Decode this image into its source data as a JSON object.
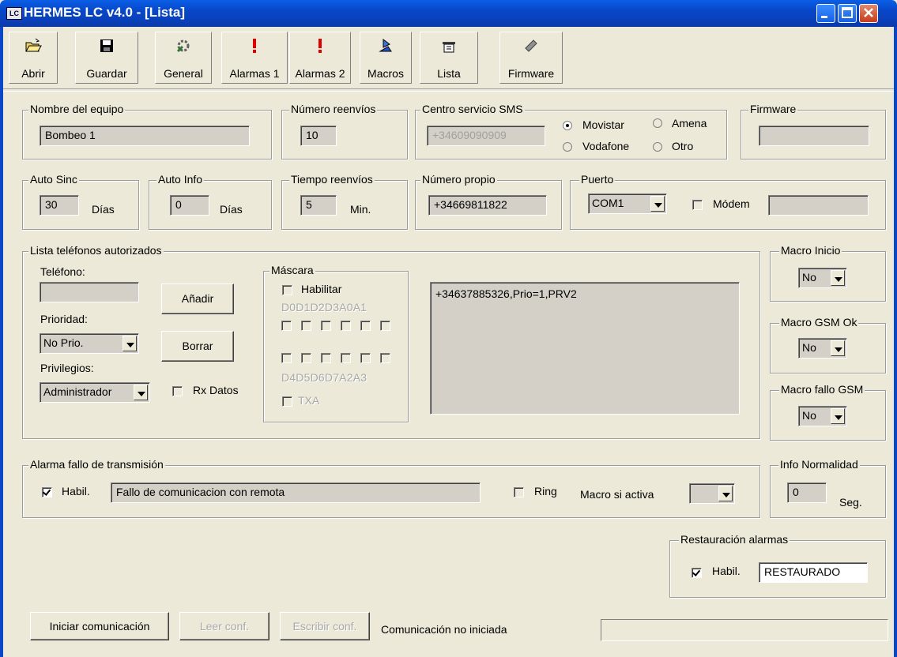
{
  "window": {
    "title": "HERMES LC v4.0 - [Lista]",
    "app_icon_text": "LC"
  },
  "toolbar": {
    "abrir": "Abrir",
    "guardar": "Guardar",
    "general": "General",
    "alarmas1": "Alarmas 1",
    "alarmas2": "Alarmas 2",
    "macros": "Macros",
    "lista": "Lista",
    "firmware": "Firmware"
  },
  "equipo": {
    "legend": "Nombre del equipo",
    "value": "Bombeo 1"
  },
  "reenvios": {
    "legend": "Número reenvíos",
    "value": "10"
  },
  "sms": {
    "legend": "Centro servicio SMS",
    "value": "+34609090909",
    "options": [
      "Movistar",
      "Amena",
      "Vodafone",
      "Otro"
    ],
    "selected": "Movistar"
  },
  "firmware_box": {
    "legend": "Firmware",
    "value": ""
  },
  "auto_sinc": {
    "legend": "Auto Sinc",
    "value": "30",
    "unit": "Días"
  },
  "auto_info": {
    "legend": "Auto Info",
    "value": "0",
    "unit": "Días"
  },
  "tiempo": {
    "legend": "Tiempo reenvíos",
    "value": "5",
    "unit": "Min."
  },
  "propio": {
    "legend": "Número propio",
    "value": "+34669811822"
  },
  "puerto": {
    "legend": "Puerto",
    "value": "COM1",
    "modem_label": "Módem",
    "modem_value": ""
  },
  "lista": {
    "legend": "Lista teléfonos autorizados",
    "telefono_label": "Teléfono:",
    "telefono_value": "",
    "prioridad_label": "Prioridad:",
    "prioridad_value": "No Prio.",
    "privilegios_label": "Privilegios:",
    "privilegios_value": "Administrador",
    "anadir": "Añadir",
    "borrar": "Borrar",
    "rx_datos": "Rx Datos",
    "entries": [
      "+34637885326,Prio=1,PRV2"
    ]
  },
  "mascara": {
    "legend": "Máscara",
    "habilitar": "Habilitar",
    "top_labels": "D0D1D2D3A0A1",
    "bottom_labels": "D4D5D6D7A2A3",
    "txa": "TXA"
  },
  "macro_inicio": {
    "legend": "Macro Inicio",
    "value": "No"
  },
  "macro_gsm_ok": {
    "legend": "Macro GSM Ok",
    "value": "No"
  },
  "macro_fallo": {
    "legend": "Macro fallo GSM",
    "value": "No"
  },
  "alarma": {
    "legend": "Alarma fallo de transmisión",
    "habil": "Habil.",
    "message": "Fallo de comunicacion con remota",
    "ring": "Ring",
    "macro_label": "Macro si activa",
    "macro_value": ""
  },
  "info_normalidad": {
    "legend": "Info Normalidad",
    "value": "0",
    "unit": "Seg."
  },
  "restauracion": {
    "legend": "Restauración alarmas",
    "habil": "Habil.",
    "value": "RESTAURADO"
  },
  "footer": {
    "iniciar": "Iniciar comunicación",
    "leer": "Leer conf.",
    "escribir": "Escribir conf.",
    "status": "Comunicación no iniciada"
  },
  "colors": {
    "title_bar": "#0a47c8",
    "dialog_bg": "#ece9d8",
    "field_bg": "#d4d0c8",
    "alert_red": "#e00000"
  }
}
